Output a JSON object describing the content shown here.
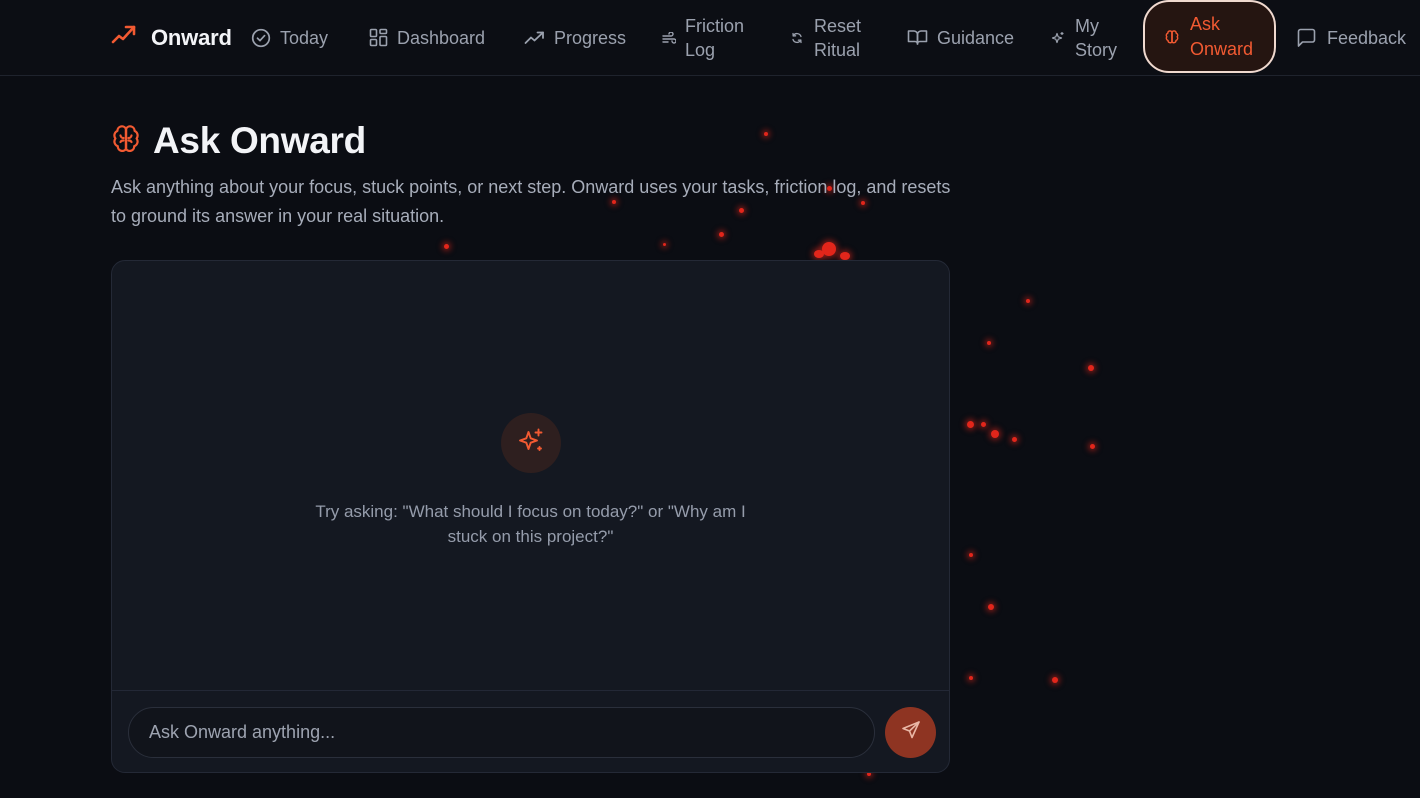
{
  "nav": {
    "brand": "Onward",
    "items": [
      {
        "label": "Today",
        "icon": "check-circle-icon"
      },
      {
        "label": "Dashboard",
        "icon": "grid-icon"
      },
      {
        "label": "Progress",
        "icon": "trending-up-icon"
      },
      {
        "label": "Friction\nLog",
        "icon": "wind-icon"
      },
      {
        "label": "Reset\nRitual",
        "icon": "refresh-icon"
      },
      {
        "label": "Guidance",
        "icon": "book-open-icon"
      },
      {
        "label": "My\nStory",
        "icon": "sparkles-icon"
      },
      {
        "label": "Ask\nOnward",
        "icon": "brain-icon",
        "active": true
      },
      {
        "label": "Feedback",
        "icon": "message-square-icon"
      }
    ]
  },
  "page": {
    "title": "Ask Onward",
    "description": "Ask anything about your focus, stuck points, or next step. Onward uses your tasks, friction log, and resets to ground its answer in your real situation."
  },
  "chat": {
    "empty_hint": "Try asking: \"What should I focus on today?\" or \"Why am I stuck on this project?\"",
    "input_placeholder": "Ask Onward anything...",
    "input_value": ""
  },
  "colors": {
    "accent": "#f25a32",
    "background": "#0b0d13",
    "card": "#141821",
    "particle": "#e2261b"
  }
}
